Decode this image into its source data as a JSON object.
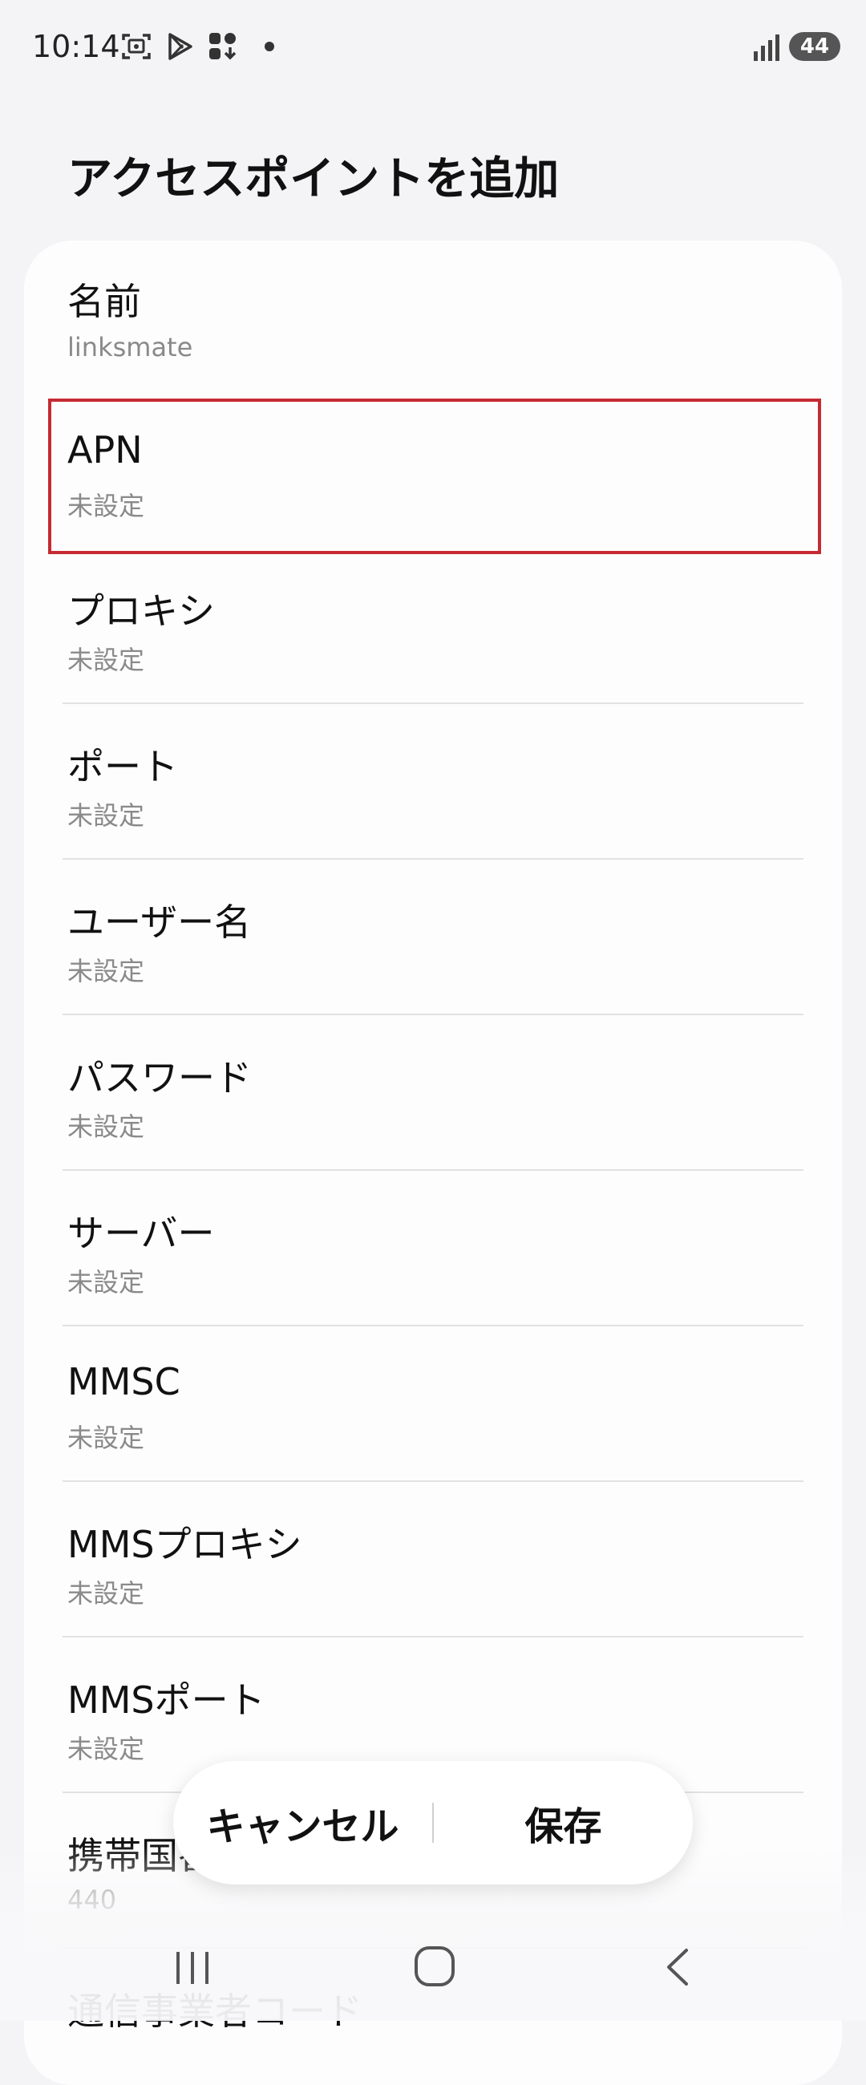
{
  "status_bar": {
    "time": "10:14",
    "battery": "44"
  },
  "title": "アクセスポイントを追加",
  "rows": [
    {
      "label": "名前",
      "value": "linksmate"
    },
    {
      "label": "APN",
      "value": "未設定"
    },
    {
      "label": "プロキシ",
      "value": "未設定"
    },
    {
      "label": "ポート",
      "value": "未設定"
    },
    {
      "label": "ユーザー名",
      "value": "未設定"
    },
    {
      "label": "パスワード",
      "value": "未設定"
    },
    {
      "label": "サーバー",
      "value": "未設定"
    },
    {
      "label": "MMSC",
      "value": "未設定"
    },
    {
      "label": "MMSプロキシ",
      "value": "未設定"
    },
    {
      "label": "MMSポート",
      "value": "未設定"
    },
    {
      "label": "携帯国番号",
      "value": "440"
    },
    {
      "label": "通信事業者コード",
      "value": ""
    }
  ],
  "actions": {
    "cancel": "キャンセル",
    "save": "保存"
  },
  "colors": {
    "highlight": "#c62a32",
    "background": "#f4f4f6"
  }
}
